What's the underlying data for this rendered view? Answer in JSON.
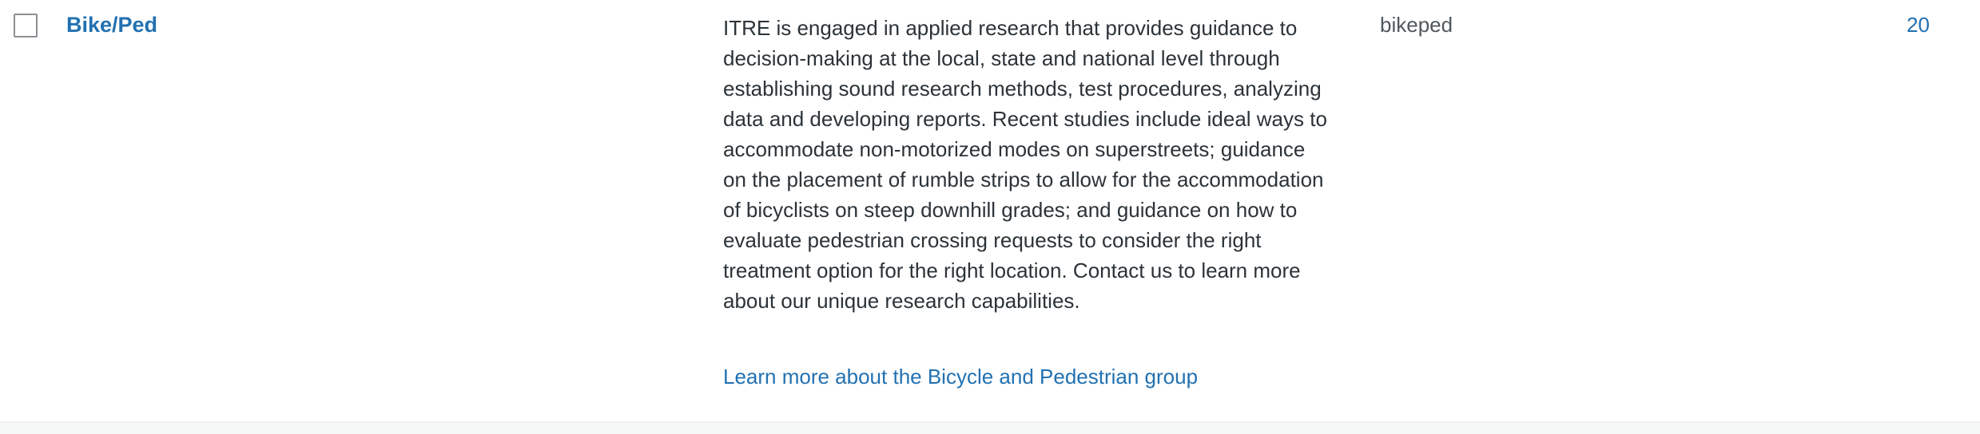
{
  "row": {
    "name": "Bike/Ped",
    "description": "ITRE is engaged in applied research that provides guidance to decision-making at the local, state and national level through establishing sound research methods, test procedures, analyzing data and developing reports. Recent studies include ideal ways to accommodate non-motorized modes on superstreets; guidance on the placement of rumble strips to allow for the accommodation of bicyclists on steep downhill grades; and guidance on how to evaluate pedestrian crossing requests to consider the right treatment option for the right location. Contact us to learn more about our unique research capabilities.",
    "description_link": "Learn more about the Bicycle and Pedestrian group",
    "slug": "bikeped",
    "count": "20"
  },
  "colors": {
    "link": "#2271b1",
    "text": "#2c3338",
    "muted": "#50575e",
    "background": "#f6f7f7"
  }
}
